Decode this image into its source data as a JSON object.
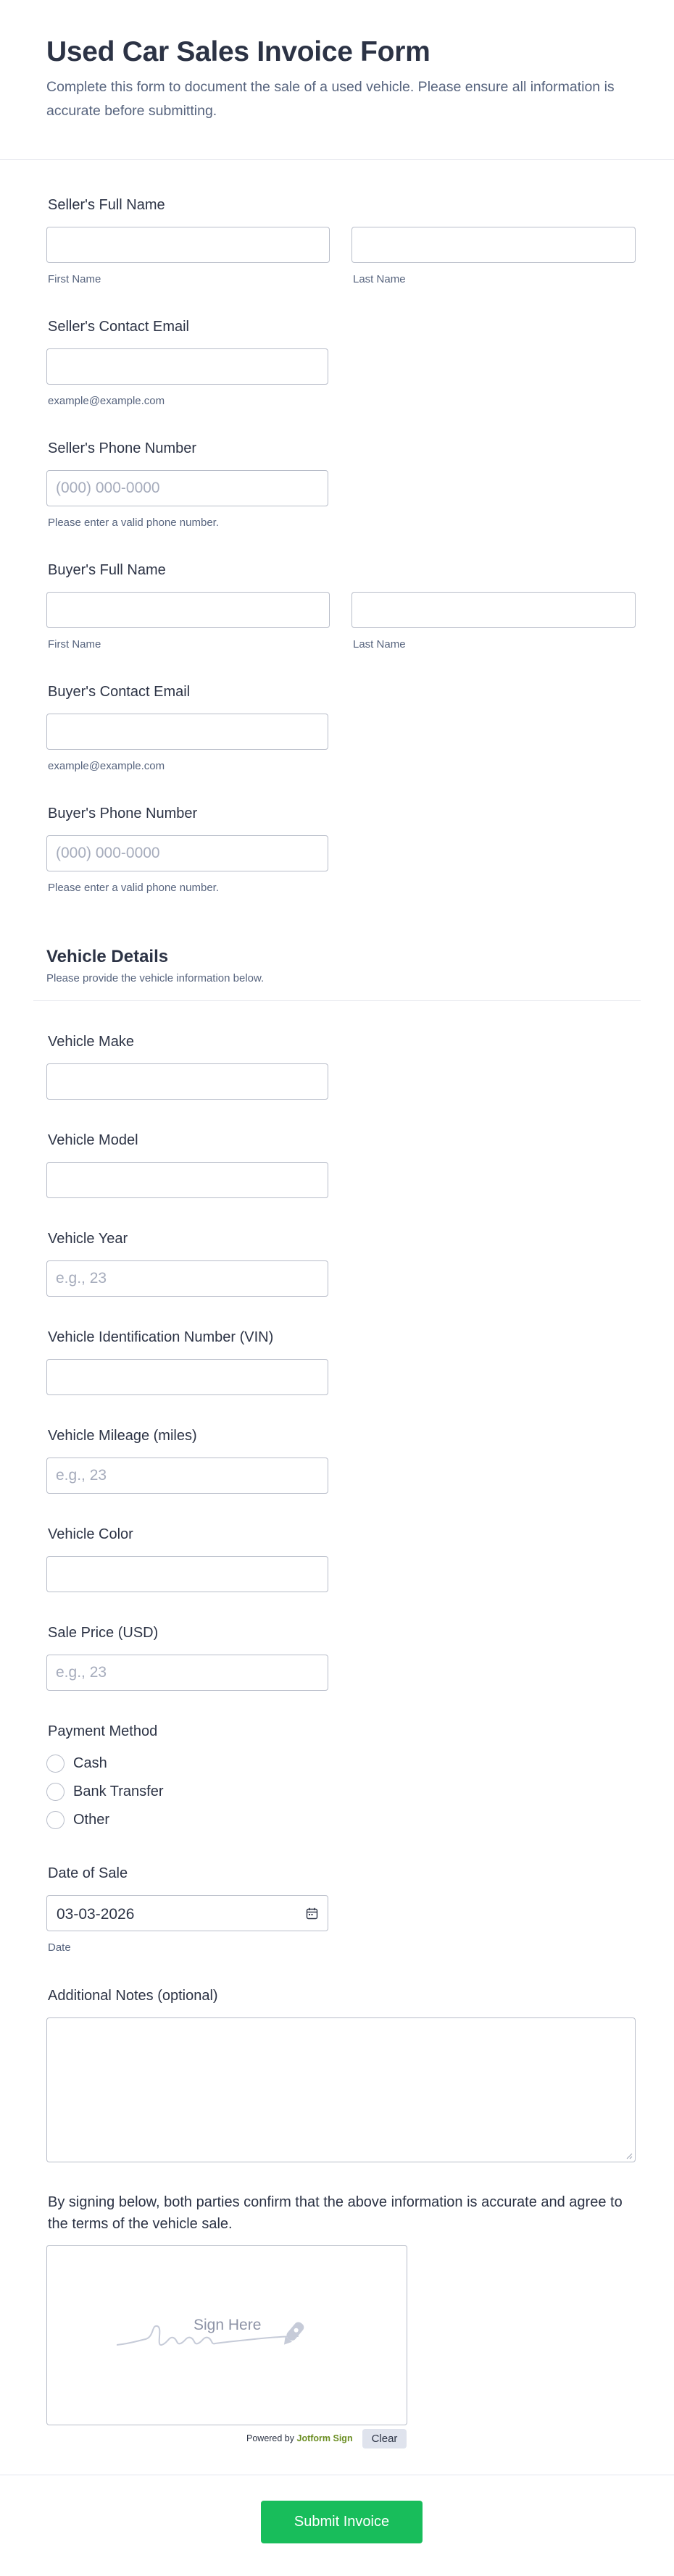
{
  "form": {
    "title": "Used Car Sales Invoice Form",
    "subtitle": "Complete this form to document the sale of a used vehicle. Please ensure all information is accurate before submitting."
  },
  "seller": {
    "name_label": "Seller's Full Name",
    "first_name_sub": "First Name",
    "last_name_sub": "Last Name",
    "email_label": "Seller's Contact Email",
    "email_sub": "example@example.com",
    "phone_label": "Seller's Phone Number",
    "phone_placeholder": "(000) 000-0000",
    "phone_sub": "Please enter a valid phone number."
  },
  "buyer": {
    "name_label": "Buyer's Full Name",
    "first_name_sub": "First Name",
    "last_name_sub": "Last Name",
    "email_label": "Buyer's Contact Email",
    "email_sub": "example@example.com",
    "phone_label": "Buyer's Phone Number",
    "phone_placeholder": "(000) 000-0000",
    "phone_sub": "Please enter a valid phone number."
  },
  "vehicle_section": {
    "title": "Vehicle Details",
    "subtitle": "Please provide the vehicle information below."
  },
  "vehicle": {
    "make_label": "Vehicle Make",
    "model_label": "Vehicle Model",
    "year_label": "Vehicle Year",
    "year_placeholder": "e.g., 23",
    "vin_label": "Vehicle Identification Number (VIN)",
    "mileage_label": "Vehicle Mileage (miles)",
    "mileage_placeholder": "e.g., 23",
    "color_label": "Vehicle Color",
    "price_label": "Sale Price (USD)",
    "price_placeholder": "e.g., 23"
  },
  "payment": {
    "label": "Payment Method",
    "options": [
      "Cash",
      "Bank Transfer",
      "Other"
    ]
  },
  "date": {
    "label": "Date of Sale",
    "value": "03-03-2026",
    "sub": "Date",
    "icon": "calendar-icon"
  },
  "notes": {
    "label": "Additional Notes (optional)"
  },
  "signature": {
    "label": "By signing below, both parties confirm that the above information is accurate and agree to the terms of the vehicle sale.",
    "placeholder": "Sign Here",
    "powered_prefix": "Powered by",
    "powered_brand": "Jotform Sign",
    "clear_label": "Clear"
  },
  "submit": {
    "label": "Submit Invoice",
    "color": "#18bd5b"
  }
}
